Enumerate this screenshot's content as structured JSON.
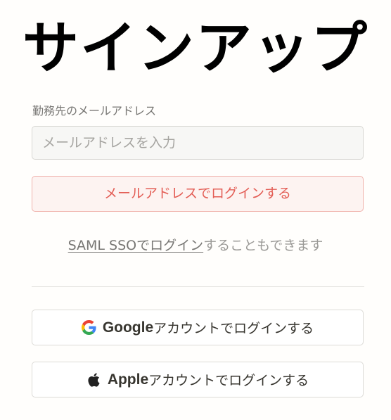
{
  "page": {
    "title": "サインアップ"
  },
  "email": {
    "label": "勤務先のメールアドレス",
    "placeholder": "メールアドレスを入力",
    "value": "",
    "submit_label": "メールアドレスでログインする"
  },
  "sso": {
    "link_text": "SAML SSOでログイン",
    "suffix_text": "することもできます"
  },
  "oauth": {
    "google": {
      "brand": "Google",
      "label": "アカウントでログインする",
      "icon": "google-icon"
    },
    "apple": {
      "brand": "Apple",
      "label": "アカウントでログインする",
      "icon": "apple-icon"
    }
  },
  "colors": {
    "accent_red": "#e35d55",
    "accent_red_bg": "#fdf3f1",
    "text_primary": "#37352f",
    "text_muted": "#787774"
  }
}
